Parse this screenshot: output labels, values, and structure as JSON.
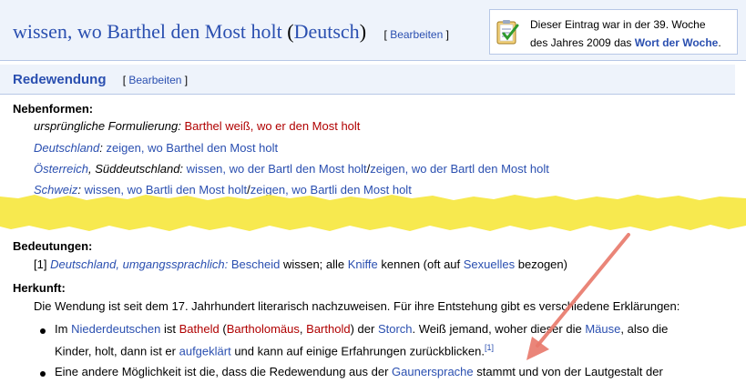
{
  "header": {
    "title_phrase": "wissen, wo Barthel den Most holt",
    "title_open": "(",
    "title_lang": "Deutsch",
    "title_close": ")",
    "edit_open": "[",
    "edit_label": "Bearbeiten",
    "edit_close": "]"
  },
  "word_of_week": {
    "line1": "Dieser Eintrag war in der 39. Woche",
    "line2_prefix": "des Jahres 2009 das",
    "line2_link": "Wort der Woche",
    "line2_suffix": ".",
    "icon": "checklist-icon"
  },
  "section": {
    "title": "Redewendung",
    "edit_open": "[",
    "edit_label": "Bearbeiten",
    "edit_close": "]"
  },
  "nebenformen": {
    "heading": "Nebenformen:",
    "row1": {
      "label": "ursprüngliche Formulierung:",
      "link": "Barthel weiß, wo er den Most holt"
    },
    "row2": {
      "region": "Deutschland",
      "colon": ":",
      "link": "zeigen, wo Barthel den Most holt"
    },
    "row3": {
      "region": "Österreich",
      "extra": ", Süddeutschland:",
      "link1": "wissen, wo der Bartl den Most holt",
      "sep": "/",
      "link2": "zeigen, wo der Bartl den Most holt"
    },
    "row4": {
      "region": "Schweiz",
      "colon": ":",
      "link1": "wissen, wo Bartli den Most holt",
      "sep": "/",
      "link2": "zeigen, wo Bartli den Most holt"
    }
  },
  "bedeutungen": {
    "heading": "Bedeutungen:",
    "num": "[1]",
    "label": "Deutschland, umgangssprachlich:",
    "link1": "Bescheid",
    "text1": "wissen; alle",
    "link2": "Kniffe",
    "text2": "kennen (oft auf",
    "link3": "Sexuelles",
    "text3": "bezogen)"
  },
  "herkunft": {
    "heading": "Herkunft:",
    "intro": "Die Wendung ist seit dem 17. Jahrhundert literarisch nachzuweisen. Für ihre Entstehung gibt es verschiedene Erklärungen:",
    "b1_t1": "Im",
    "b1_l1": "Niederdeutschen",
    "b1_t2": "ist",
    "b1_l2": "Batheld",
    "b1_t3": "(",
    "b1_l3": "Bartholomäus",
    "b1_t4": ",",
    "b1_l4": "Barthold",
    "b1_t5": ") der",
    "b1_l5": "Storch",
    "b1_t6": ". Weiß jemand, woher dieser die",
    "b1_l6": "Mäuse",
    "b1_t7": ", also die",
    "b1_line2_t1": "Kinder, holt, dann ist er",
    "b1_line2_l1": "aufgeklärt",
    "b1_line2_t2": "und kann auf einige Erfahrungen zurückblicken.",
    "b1_ref": "[1]",
    "b2_t1": "Eine andere Möglichkeit ist die, dass die Redewendung aus der",
    "b2_l1": "Gaunersprache",
    "b2_t2": "stammt und von der Lautgestalt der"
  },
  "colors": {
    "link": "#2a4fb0",
    "redlink": "#b00000",
    "header_bg": "#eef3fb",
    "torn": "#f7e94f",
    "arrow": "#e8786a"
  }
}
